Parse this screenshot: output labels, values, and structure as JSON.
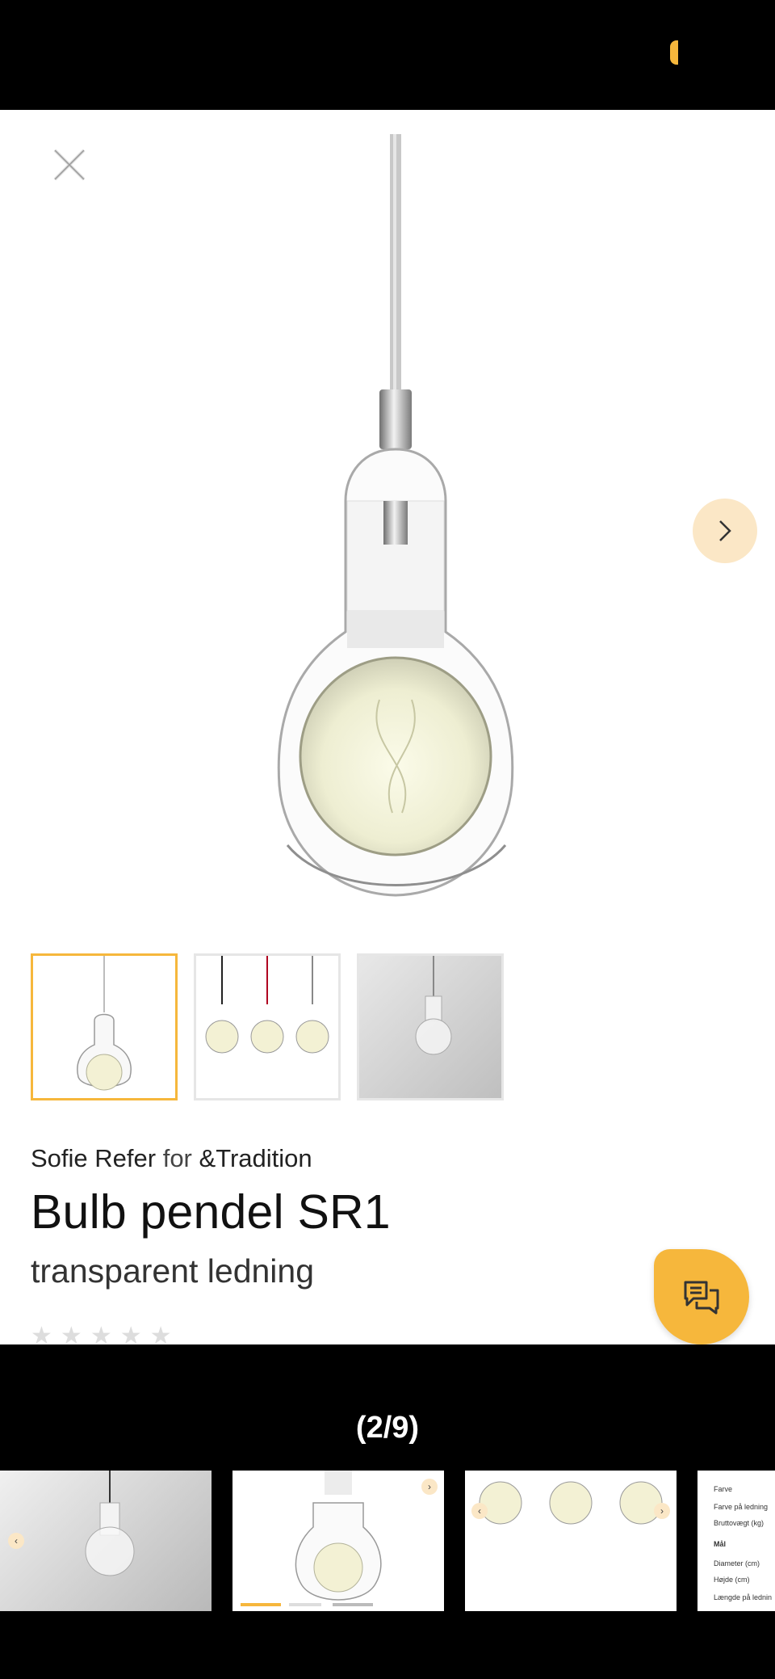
{
  "gallery": {
    "counter": "(2/9)"
  },
  "product": {
    "designer": "Sofie Refer",
    "for_word": "for",
    "brand": "&Tradition",
    "name": "Bulb pendel SR1",
    "variant": "transparent ledning"
  },
  "spec_preview": {
    "lines": [
      "Farve",
      "Farve på ledning",
      "Bruttovægt (kg)",
      "Mål",
      "Diameter (cm)",
      "Højde (cm)",
      "Længde på lednin"
    ]
  },
  "colors": {
    "accent": "#f6b73c",
    "accent_light": "#fbe7c6"
  },
  "icons": {
    "close": "close-icon",
    "next": "chevron-right-icon",
    "chat": "chat-icon",
    "star": "star-icon"
  }
}
